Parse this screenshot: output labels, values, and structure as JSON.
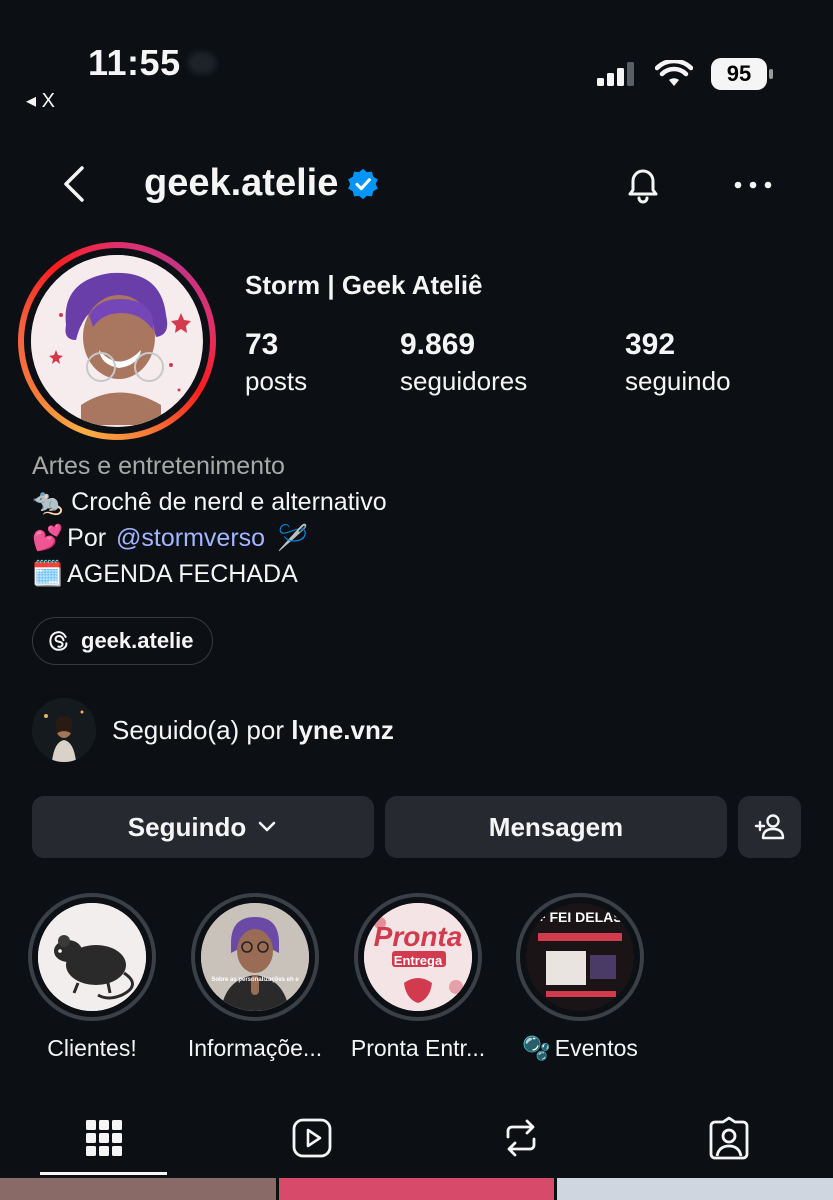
{
  "status_bar": {
    "time": "11:55",
    "back_app": "◂ X",
    "battery": "95"
  },
  "header": {
    "username": "geek.atelie"
  },
  "profile": {
    "display_name": "Storm | Geek Ateliê",
    "stats": [
      {
        "value": "73",
        "label": "posts"
      },
      {
        "value": "9.869",
        "label": "seguidores"
      },
      {
        "value": "392",
        "label": "seguindo"
      }
    ],
    "category": "Artes e entretenimento",
    "bio": {
      "line1_emoji": "🐀",
      "line1_text": "Crochê de nerd e alternativo",
      "line2_emoji": "💕",
      "line2_prefix": "Por",
      "line2_mention": "@stormverso",
      "line2_suffix_emoji": "🪡",
      "line3_emoji": "🗓️",
      "line3_text": "AGENDA FECHADA"
    },
    "threads_handle": "geek.atelie",
    "followed_by_prefix": "Seguido(a) por",
    "followed_by_user": "lyne.vnz"
  },
  "actions": {
    "following": "Seguindo",
    "message": "Mensagem"
  },
  "highlights": [
    {
      "label": "Clientes!",
      "prefix": ""
    },
    {
      "label": "Informaçõe...",
      "prefix": ""
    },
    {
      "label": "Pronta Entr...",
      "prefix": ""
    },
    {
      "label": "Eventos",
      "prefix": "🫧"
    }
  ],
  "highlight_thumbs": {
    "pronta_title": "Pronta",
    "pronta_sub": "Entrega",
    "info_caption": "Sobre as personalizações eh e",
    "eventos_title": "+ FEI DELAS"
  },
  "icons": {
    "back": "chevron-left-icon",
    "verified": "verified-badge-icon",
    "bell": "bell-icon",
    "more": "more-horizontal-icon",
    "threads": "threads-icon",
    "add_person": "add-person-icon",
    "grid": "grid-icon",
    "reels": "reels-icon",
    "reposts": "repost-icon",
    "tagged": "tagged-icon"
  },
  "colors": {
    "background": "#0c1014",
    "button": "#262a30",
    "mention": "#a3b5ff",
    "verified": "#0095f6"
  }
}
